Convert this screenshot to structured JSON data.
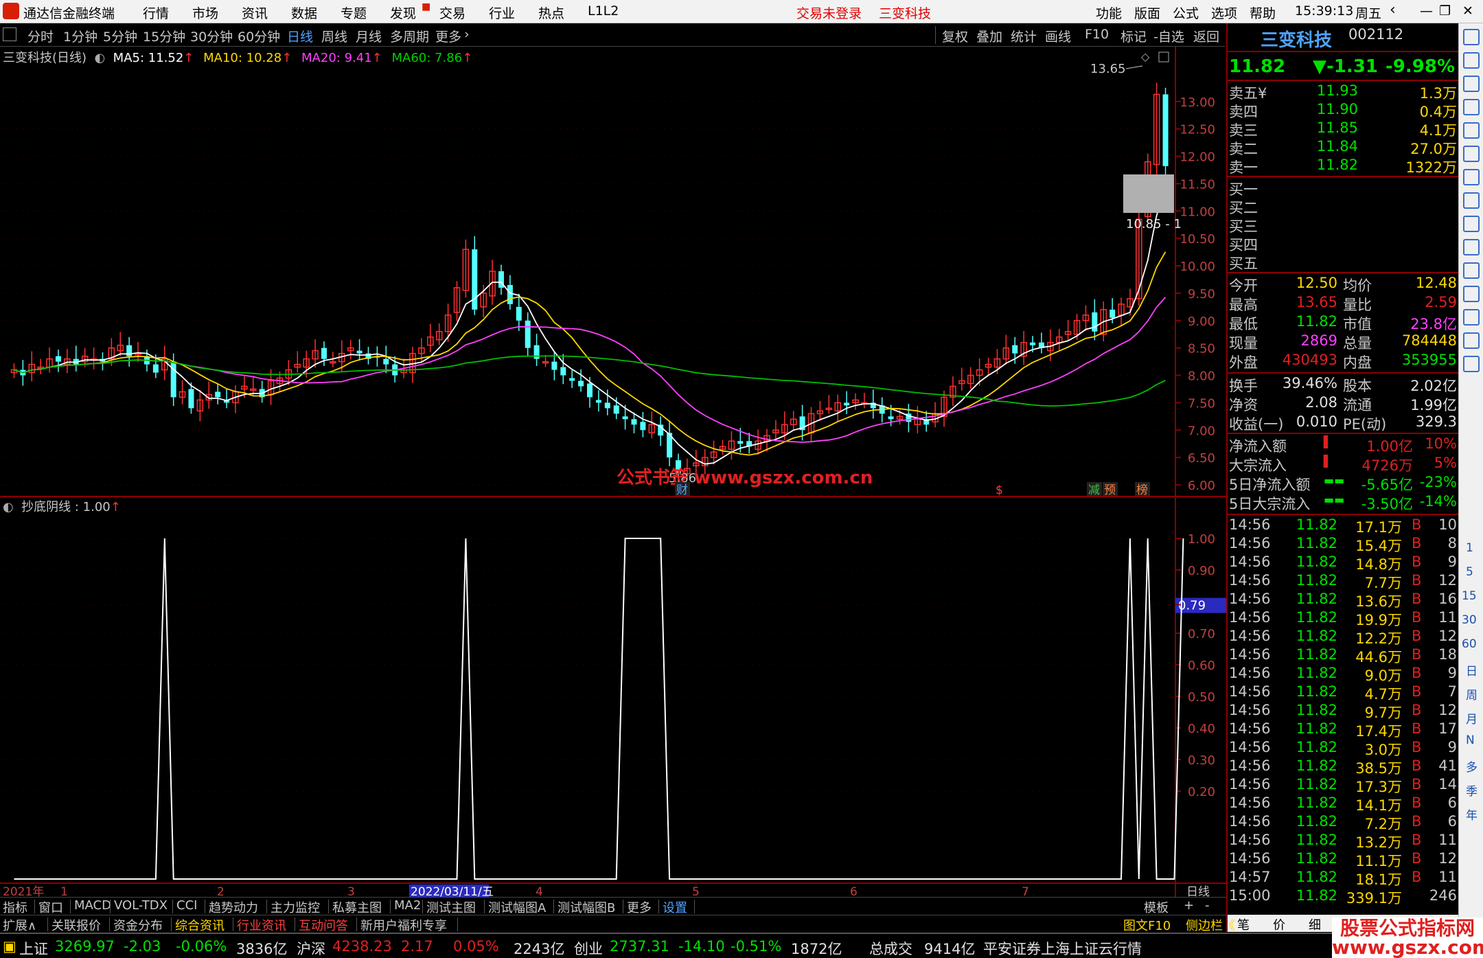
{
  "menubar": {
    "app_title": "通达信金融终端",
    "items": [
      "行情",
      "市场",
      "资讯",
      "数据",
      "专题",
      "发现",
      "交易",
      "行业",
      "热点",
      "L1L2"
    ],
    "notice_login": "交易未登录",
    "notice_stock": "三变科技",
    "right_items": [
      "功能",
      "版面",
      "公式",
      "选项",
      "帮助"
    ],
    "time": "15:39:13",
    "weekday": "周五"
  },
  "toolbar": {
    "periods": [
      "分时",
      "1分钟",
      "5分钟",
      "15分钟",
      "30分钟",
      "60分钟",
      "日线",
      "周线",
      "月线",
      "多周期",
      "更多"
    ],
    "active": "日线",
    "actions": [
      "复权",
      "叠加",
      "统计",
      "画线",
      "F10",
      "标记",
      "-自选",
      "返回"
    ]
  },
  "main_legend": {
    "name": "三变科技(日线)",
    "ma5": "MA5: 11.52",
    "ma10": "MA10: 10.28",
    "ma20": "MA20: 9.41",
    "ma60": "MA60: 7.86"
  },
  "sub_legend": {
    "name": "抄底阴线 : 1.00"
  },
  "chart_data": [
    {
      "type": "candlestick",
      "title": "三变科技(日线)",
      "ylim": [
        5.8,
        13.9
      ],
      "yticks": [
        "13.00",
        "12.50",
        "12.00",
        "11.50",
        "11.00",
        "10.50",
        "10.00",
        "9.50",
        "9.00",
        "8.50",
        "8.00",
        "7.50",
        "7.00",
        "6.50",
        "6.00"
      ],
      "close": [
        8.1,
        8.0,
        8.2,
        8.15,
        8.3,
        8.25,
        8.3,
        8.2,
        8.35,
        8.3,
        8.25,
        8.5,
        8.55,
        8.35,
        8.4,
        8.2,
        8.05,
        8.3,
        7.6,
        7.7,
        7.4,
        7.55,
        7.65,
        7.6,
        7.5,
        7.7,
        7.8,
        7.75,
        7.6,
        7.9,
        7.95,
        8.1,
        8.2,
        8.3,
        8.45,
        8.3,
        8.25,
        8.4,
        8.5,
        8.4,
        8.3,
        8.35,
        8.2,
        8.0,
        8.1,
        8.4,
        8.5,
        8.7,
        8.8,
        9.1,
        9.6,
        10.3,
        9.2,
        9.5,
        9.9,
        9.6,
        9.3,
        9.0,
        8.5,
        8.3,
        8.25,
        8.1,
        8.0,
        7.9,
        7.8,
        7.6,
        7.5,
        7.4,
        7.3,
        7.2,
        7.1,
        7.0,
        7.1,
        6.9,
        6.5,
        6.2,
        6.3,
        6.4,
        6.5,
        6.6,
        6.7,
        6.8,
        6.75,
        6.7,
        6.8,
        6.9,
        7.0,
        7.1,
        7.2,
        7.0,
        7.3,
        7.35,
        7.4,
        7.5,
        7.45,
        7.55,
        7.5,
        7.4,
        7.3,
        7.2,
        7.25,
        7.15,
        7.2,
        7.1,
        7.3,
        7.6,
        7.8,
        7.9,
        8.0,
        8.1,
        8.2,
        8.3,
        8.5,
        8.4,
        8.6,
        8.55,
        8.5,
        8.6,
        8.7,
        8.8,
        9.0,
        9.1,
        8.8,
        9.2,
        9.05,
        9.3,
        9.4,
        10.85,
        11.9,
        13.13,
        11.82
      ],
      "vol_note": "no volume panel shown",
      "labels": {
        "high_label": "13.65",
        "low_label": "5.86",
        "price_box": "10.85 - 1"
      },
      "overlay_text": "公式书签 www.gszx.com.cn",
      "markers": [
        "财",
        "$",
        "减",
        "预",
        "榜"
      ],
      "series": [
        {
          "name": "MA5",
          "color": "#ffffff"
        },
        {
          "name": "MA10",
          "color": "#ffd700"
        },
        {
          "name": "MA20",
          "color": "#ff40ff"
        },
        {
          "name": "MA60",
          "color": "#00c000"
        }
      ]
    },
    {
      "type": "line",
      "title": "抄底阴线",
      "ylim": [
        0,
        1.05
      ],
      "yticks": [
        "1.00",
        "0.90",
        "0.79",
        "0.70",
        "0.60",
        "0.50",
        "0.40",
        "0.30",
        "0.20"
      ],
      "highlight_tick": "0.79",
      "series": [
        {
          "name": "抄底阴线",
          "values": [
            0,
            0,
            0,
            0,
            0,
            0,
            0,
            0,
            0,
            0,
            0,
            0,
            0,
            0,
            0,
            0,
            0,
            1,
            0,
            0,
            0,
            0,
            0,
            0,
            0,
            0,
            0,
            0,
            0,
            0,
            0,
            0,
            0,
            0,
            0,
            0,
            0,
            0,
            0,
            0,
            0,
            0,
            0,
            0,
            0,
            0,
            0,
            0,
            0,
            0,
            0,
            1,
            0,
            0,
            0,
            0,
            0,
            0,
            0,
            0,
            0,
            0,
            0,
            0,
            0,
            0,
            0,
            0,
            0,
            1,
            1,
            1,
            1,
            1,
            0,
            0,
            0,
            0,
            0,
            0,
            0,
            0,
            0,
            0,
            0,
            0,
            0,
            0,
            0,
            0,
            0,
            0,
            0,
            0,
            0,
            0,
            0,
            0,
            0,
            0,
            0,
            0,
            0,
            0,
            0,
            0,
            0,
            0,
            0,
            0,
            0,
            0,
            0,
            0,
            0,
            0,
            0,
            0,
            0,
            0,
            0,
            0,
            0,
            0,
            0,
            0,
            1,
            0,
            1,
            0,
            0,
            0,
            1
          ]
        }
      ],
      "xaxis": {
        "labels": [
          "2021年",
          "1",
          "2",
          "3",
          "2022/03/11/五",
          "4",
          "5",
          "6",
          "7"
        ],
        "period": "日线"
      }
    }
  ],
  "quote": {
    "name": "三变科技",
    "code": "002112",
    "price": "11.82",
    "change": "▼-1.31",
    "pct": "-9.98%",
    "asks": [
      {
        "label": "卖五¥",
        "price": "11.93",
        "vol": "1.3万"
      },
      {
        "label": "卖四",
        "price": "11.90",
        "vol": "0.4万"
      },
      {
        "label": "卖三",
        "price": "11.85",
        "vol": "4.1万"
      },
      {
        "label": "卖二",
        "price": "11.84",
        "vol": "27.0万"
      },
      {
        "label": "卖一",
        "price": "11.82",
        "vol": "1322万"
      }
    ],
    "bids": [
      "买一",
      "买二",
      "买三",
      "买四",
      "买五"
    ],
    "stats": [
      [
        "今开",
        "12.50",
        "均价",
        "12.48"
      ],
      [
        "最高",
        "13.65",
        "量比",
        "2.59"
      ],
      [
        "最低",
        "11.82",
        "市值",
        "23.8亿"
      ],
      [
        "现量",
        "2869",
        "总量",
        "784448"
      ],
      [
        "外盘",
        "430493",
        "内盘",
        "353955"
      ]
    ],
    "stats2": [
      [
        "换手",
        "39.46%",
        "股本",
        "2.02亿"
      ],
      [
        "净资",
        "2.08",
        "流通",
        "1.99亿"
      ],
      [
        "收益(一)",
        "0.010",
        "PE(动)",
        "329.3"
      ]
    ],
    "flows": [
      [
        "净流入额",
        "1.00亿",
        "10%"
      ],
      [
        "大宗流入",
        "4726万",
        "5%"
      ],
      [
        "5日净流入额",
        "-5.65亿",
        "-23%"
      ],
      [
        "5日大宗流入",
        "-3.50亿",
        "-14%"
      ]
    ],
    "ticks": [
      [
        "14:56",
        "11.82",
        "17.1万",
        "B",
        "10"
      ],
      [
        "14:56",
        "11.82",
        "15.4万",
        "B",
        "8"
      ],
      [
        "14:56",
        "11.82",
        "14.8万",
        "B",
        "9"
      ],
      [
        "14:56",
        "11.82",
        "7.7万",
        "B",
        "12"
      ],
      [
        "14:56",
        "11.82",
        "13.6万",
        "B",
        "16"
      ],
      [
        "14:56",
        "11.82",
        "19.9万",
        "B",
        "11"
      ],
      [
        "14:56",
        "11.82",
        "12.2万",
        "B",
        "12"
      ],
      [
        "14:56",
        "11.82",
        "44.6万",
        "B",
        "18"
      ],
      [
        "14:56",
        "11.82",
        "9.0万",
        "B",
        "9"
      ],
      [
        "14:56",
        "11.82",
        "4.7万",
        "B",
        "7"
      ],
      [
        "14:56",
        "11.82",
        "9.7万",
        "B",
        "12"
      ],
      [
        "14:56",
        "11.82",
        "17.4万",
        "B",
        "17"
      ],
      [
        "14:56",
        "11.82",
        "3.0万",
        "B",
        "9"
      ],
      [
        "14:56",
        "11.82",
        "38.5万",
        "B",
        "41"
      ],
      [
        "14:56",
        "11.82",
        "17.3万",
        "B",
        "14"
      ],
      [
        "14:56",
        "11.82",
        "14.1万",
        "B",
        "6"
      ],
      [
        "14:56",
        "11.82",
        "7.2万",
        "B",
        "6"
      ],
      [
        "14:56",
        "11.82",
        "13.2万",
        "B",
        "11"
      ],
      [
        "14:56",
        "11.82",
        "11.1万",
        "B",
        "12"
      ],
      [
        "14:57",
        "11.82",
        "18.1万",
        "B",
        "11"
      ],
      [
        "15:00",
        "11.82",
        "339.1万",
        "",
        "246"
      ]
    ]
  },
  "tabs1": [
    "指标",
    "窗口",
    "MACD",
    "VOL-TDX",
    "CCI",
    "趋势动力",
    "主力监控",
    "私募主图",
    "MA2",
    "测试主图",
    "测试幅图A",
    "测试幅图B",
    "更多",
    "设置"
  ],
  "tabs1_right": [
    "模板",
    "+",
    "-"
  ],
  "tabs2": [
    "扩展∧",
    "关联报价",
    "资金分布",
    "综合资讯",
    "行业资讯",
    "互动问答",
    "新用户福利专享"
  ],
  "tabs2_right": [
    "图文F10",
    "侧边栏《"
  ],
  "rp_bottom_tabs": [
    "笔",
    "价",
    "细",
    "势"
  ],
  "iconbar_side": [
    "1",
    "5",
    "15",
    "30",
    "60",
    "日",
    "周",
    "月",
    "N",
    "多",
    "季",
    "年"
  ],
  "status": [
    {
      "name": "上证",
      "val": "3269.97",
      "chg": "-2.03",
      "pct": "-0.06%",
      "amt": "3836亿"
    },
    {
      "name": "沪深",
      "val": "4238.23",
      "chg": "2.17",
      "pct": "0.05%",
      "amt": "2243亿"
    },
    {
      "name": "创业",
      "val": "2737.31",
      "chg": "-14.10",
      "pct": "-0.51%",
      "amt": "1872亿"
    }
  ],
  "status_total": {
    "label": "总成交",
    "val": "9414亿"
  },
  "status_msg": "平安证券上海上证云行情",
  "watermark": "股票公式指标网\nwww.gszx.com.cn"
}
